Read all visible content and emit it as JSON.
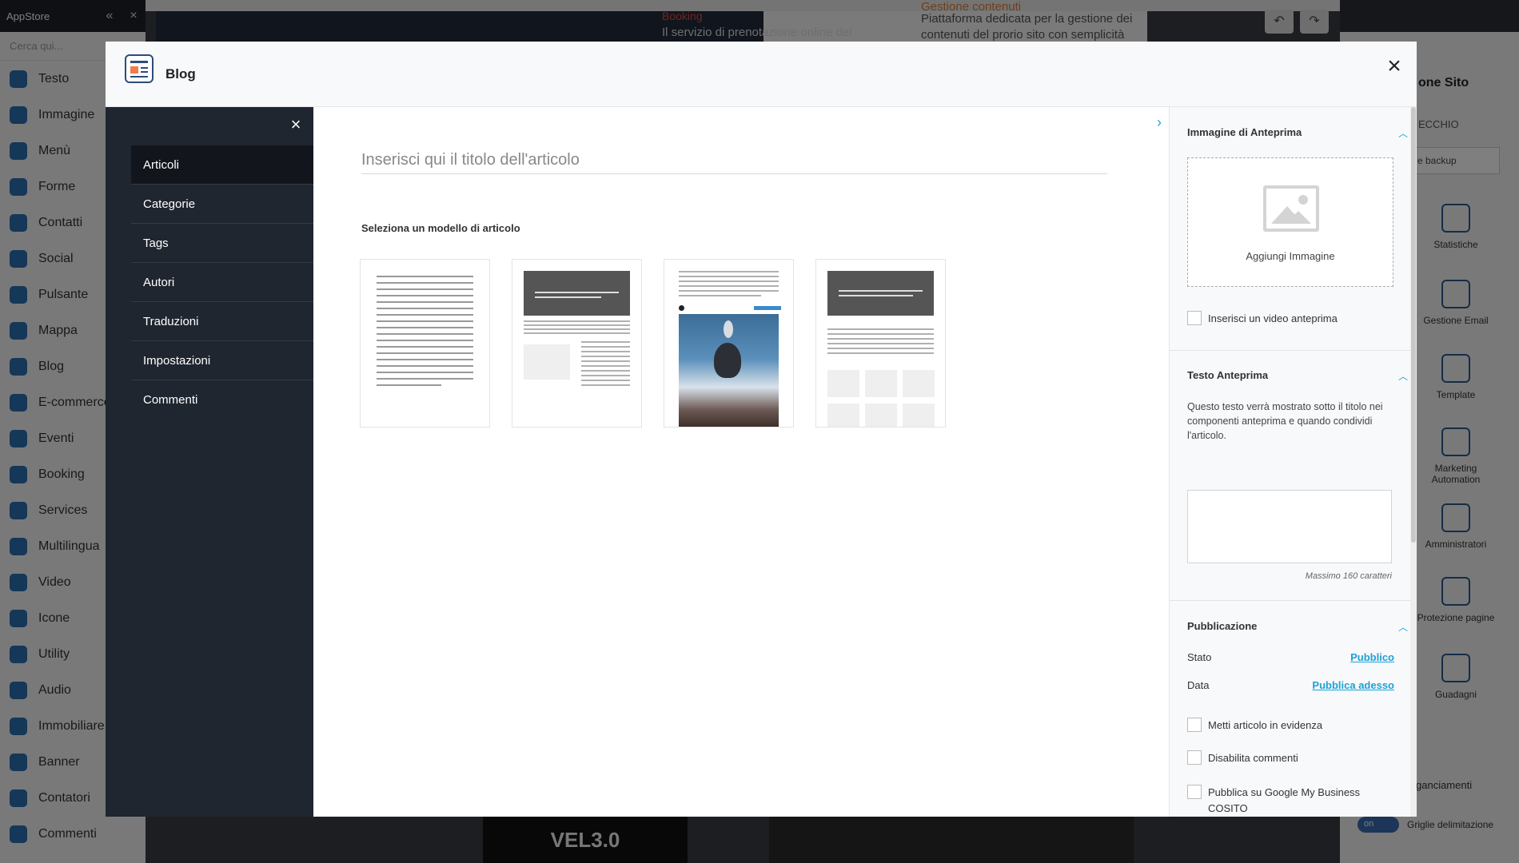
{
  "background": {
    "left_sidebar": {
      "title": "AppStore",
      "search_placeholder": "Cerca qui...",
      "items": [
        "Testo",
        "Immagine",
        "Menù",
        "Forme",
        "Contatti",
        "Social",
        "Pulsante",
        "Mappa",
        "Blog",
        "E-commerce",
        "Eventi",
        "Booking",
        "Services",
        "Multilingua",
        "Video",
        "Icone",
        "Utility",
        "Audio",
        "Immobiliare",
        "Banner",
        "Contatori",
        "Commenti"
      ]
    },
    "canvas": {
      "booking_title": "Booking",
      "booking_sub": "Il servizio di prenotazione online del",
      "gestione_title": "Gestione contenuti",
      "gestione_sub": "Piattaforma dedicata per la gestione dei contenuti del prorio sito con semplicità",
      "bottom_text": "VEL3.0"
    },
    "right_panel": {
      "title": "one Sito",
      "sub": "ECCHIO",
      "select": "e backup",
      "tiles": [
        "Statistiche",
        "Gestione Email",
        "Template",
        "Marketing Automation",
        "Amministratori",
        "Protezione pagine",
        "Guadagni"
      ],
      "bottom_label": "ganciamenti",
      "toggle": "on",
      "toggle_label": "Griglie delimitazione"
    }
  },
  "modal": {
    "title": "Blog",
    "close_icon": "×",
    "nav": {
      "close_icon": "×",
      "items": [
        "Articoli",
        "Categorie",
        "Tags",
        "Autori",
        "Traduzioni",
        "Impostazioni",
        "Commenti"
      ],
      "active": "Articoli"
    },
    "main": {
      "title_placeholder": "Inserisci qui il titolo dell'articolo",
      "template_label": "Seleziona un modello di articolo"
    },
    "right_panel": {
      "toggle_icon": "›",
      "preview_image": {
        "heading": "Immagine di Anteprima",
        "add_label": "Aggiungi Immagine",
        "video_checkbox": "Inserisci un video anteprima"
      },
      "preview_text": {
        "heading": "Testo Anteprima",
        "description": "Questo testo verrà mostrato sotto il titolo nei componenti anteprima e quando condividi l'articolo.",
        "max_chars": "Massimo 160 caratteri"
      },
      "publication": {
        "heading": "Pubblicazione",
        "state_label": "Stato",
        "state_value": "Pubblico",
        "date_label": "Data",
        "date_value": "Pubblica adesso",
        "checkboxes": [
          "Metti articolo in evidenza",
          "Disabilita commenti",
          "Pubblica su Google My Business COSITO"
        ]
      }
    }
  },
  "colors": {
    "accent": "#1da1d6",
    "nav_bg": "#20262f",
    "overlay": "rgba(0,0,0,0.5)"
  }
}
